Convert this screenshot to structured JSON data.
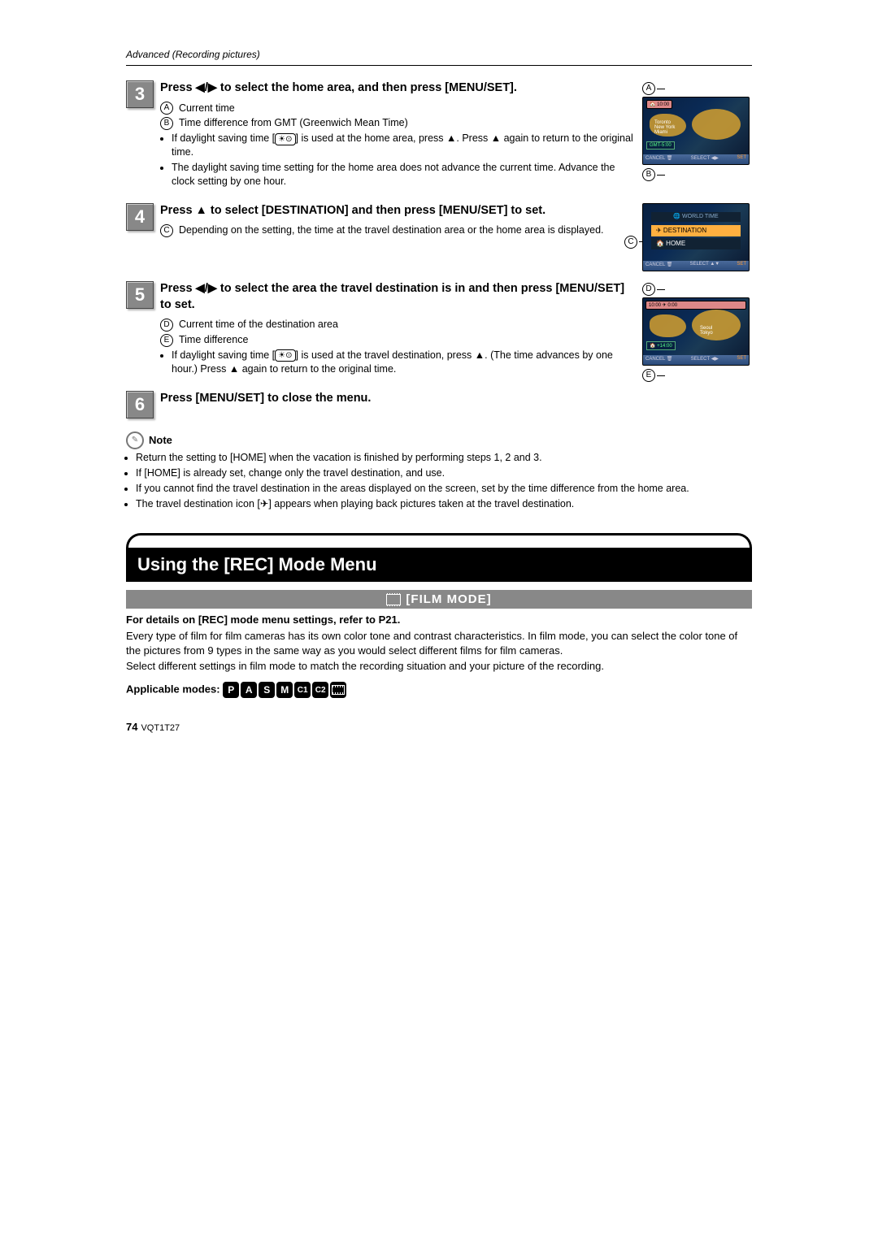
{
  "header": {
    "section_title": "Advanced (Recording pictures)"
  },
  "steps": {
    "s3": {
      "num": "3",
      "title_pre": "Press ",
      "title_mid": " to select the home area, and then press [MENU/SET].",
      "a_label": "A",
      "a_text": "Current time",
      "b_label": "B",
      "b_text": "Time difference from GMT (Greenwich Mean Time)",
      "bullet1_pre": "If daylight saving time [",
      "bullet1_post": "] is used at the home area, press ▲. Press ▲ again to return to the original time.",
      "bullet2": "The daylight saving time setting for the home area does not advance the current time. Advance the clock setting by one hour.",
      "screen": {
        "top_tab": "🏠 10:00",
        "city_hint": "Toronto\nNew York\nMiami",
        "gmt": "GMT-5:00",
        "bottom_cancel": "CANCEL 🗑",
        "bottom_select": "SELECT ◀▶",
        "bottom_set": "SET"
      }
    },
    "s4": {
      "num": "4",
      "title": "Press ▲ to select [DESTINATION] and then press [MENU/SET] to set.",
      "c_label": "C",
      "c_text": "Depending on the setting, the time at the travel destination area or the home area is displayed.",
      "screen": {
        "head": "🌐 WORLD TIME",
        "item_dest": "✈ DESTINATION",
        "item_home": "🏠 HOME",
        "bottom_cancel": "CANCEL 🗑",
        "bottom_select": "SELECT ▲▼",
        "bottom_set": "SET"
      }
    },
    "s5": {
      "num": "5",
      "title_pre": "Press ",
      "title_post": " to select the area the travel destination is in and then press [MENU/SET] to set.",
      "d_label": "D",
      "d_text": "Current time of the destination area",
      "e_label": "E",
      "e_text": "Time difference",
      "bullet_pre": "If daylight saving time [",
      "bullet_post": "] is used at the travel destination, press ▲. (The time advances by one hour.) Press ▲ again to return to the original time.",
      "screen": {
        "top_tab": "10:00        ✈ 0:00",
        "city_hint": "Seoul\nTokyo",
        "gmt": "🏠 +14:00",
        "bottom_cancel": "CANCEL 🗑",
        "bottom_select": "SELECT ◀▶",
        "bottom_set": "SET"
      }
    },
    "s6": {
      "num": "6",
      "title": "Press [MENU/SET] to close the menu."
    }
  },
  "note": {
    "label": "Note",
    "b1": "Return the setting to [HOME] when the vacation is finished by performing steps 1, 2 and 3.",
    "b2": "If [HOME] is already set, change only the travel destination, and use.",
    "b3": "If you cannot find the travel destination in the areas displayed on the screen, set by the time difference from the home area.",
    "b4_pre": "The travel destination icon [",
    "b4_post": "] appears when playing back pictures taken at the travel destination."
  },
  "section2": {
    "title": "Using the [REC] Mode Menu",
    "sub_title": "[FILM MODE]",
    "para_bold": "For details on [REC] mode menu settings, refer to P21.",
    "para1": "Every type of film for film cameras has its own color tone and contrast characteristics. In film mode, you can select the color tone of the pictures from 9 types in the same way as you would select different films for film cameras.",
    "para2": "Select different settings in film mode to match the recording situation and your picture of the recording.",
    "applicable_label": "Applicable modes:",
    "modes": [
      "P",
      "A",
      "S",
      "M",
      "C1",
      "C2"
    ]
  },
  "footer": {
    "page_num": "74",
    "manual_code": "VQT1T27"
  }
}
